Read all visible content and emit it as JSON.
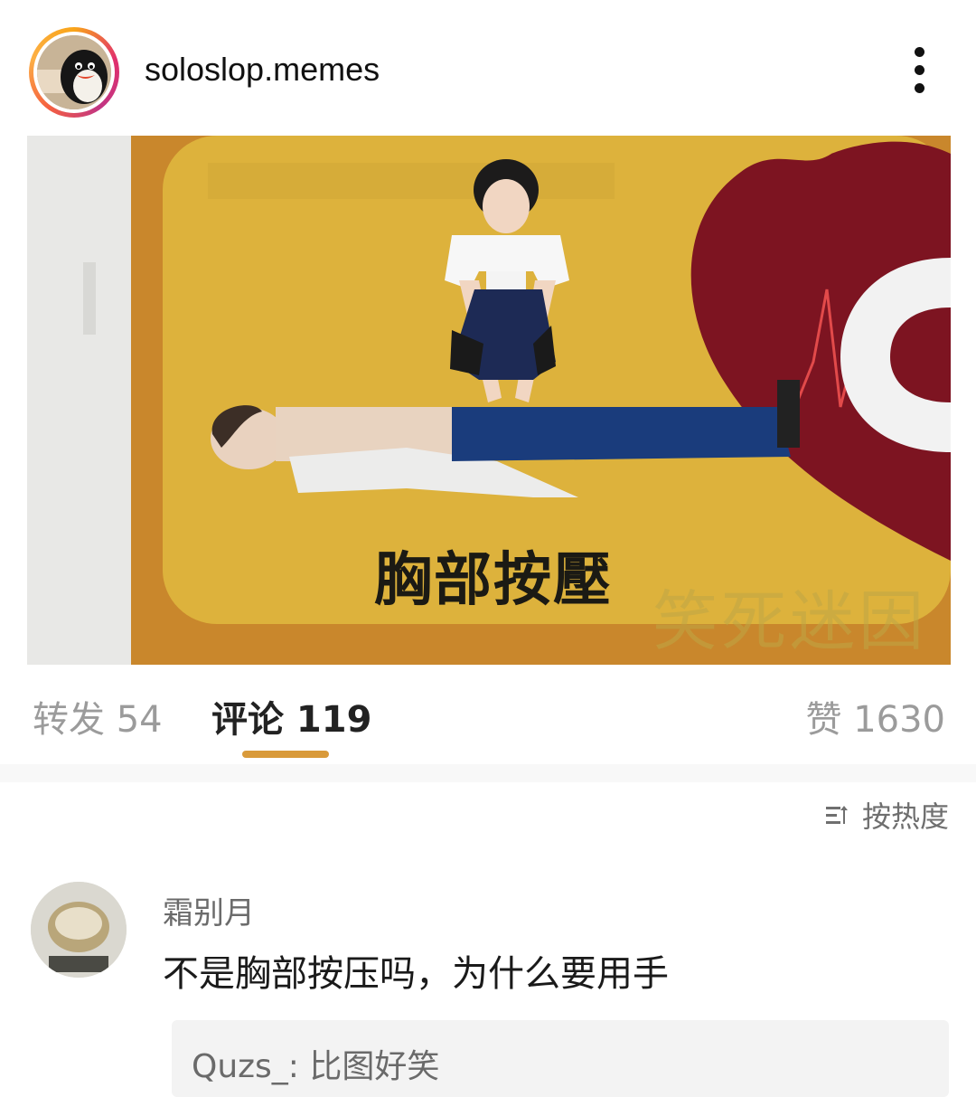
{
  "header": {
    "username": "soloslop.memes"
  },
  "post": {
    "watermark": "笑死迷因",
    "caption": "胸部按壓"
  },
  "stats": {
    "repost_label": "转发 54",
    "comments_label": "评论 119",
    "likes_label": "赞 1630"
  },
  "sort": {
    "label": "按热度"
  },
  "comment": {
    "author": "霜别月",
    "text": "不是胸部按压吗，为什么要用手",
    "reply": "Quzs_: 比图好笑"
  },
  "colors": {
    "poster_yellow": "#d9ad32",
    "heart_red": "#7d1421",
    "tab_underline": "#d99a3a"
  }
}
